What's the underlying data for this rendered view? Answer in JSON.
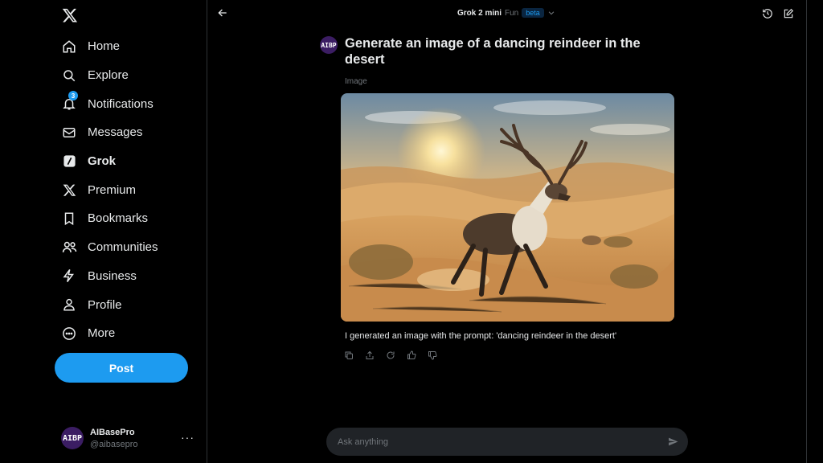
{
  "sidebar": {
    "logo": "x-logo-icon",
    "items": [
      {
        "label": "Home",
        "icon": "home-icon"
      },
      {
        "label": "Explore",
        "icon": "search-icon"
      },
      {
        "label": "Notifications",
        "icon": "bell-icon",
        "badge": "3"
      },
      {
        "label": "Messages",
        "icon": "envelope-icon"
      },
      {
        "label": "Grok",
        "icon": "grok-icon",
        "active": true
      },
      {
        "label": "Premium",
        "icon": "x-icon"
      },
      {
        "label": "Bookmarks",
        "icon": "bookmark-icon"
      },
      {
        "label": "Communities",
        "icon": "people-icon"
      },
      {
        "label": "Business",
        "icon": "lightning-icon"
      },
      {
        "label": "Profile",
        "icon": "person-icon"
      },
      {
        "label": "More",
        "icon": "more-circle-icon"
      }
    ],
    "post_label": "Post",
    "account": {
      "avatar_text": "AIBP",
      "name": "AIBasePro",
      "handle": "@aibasepro",
      "more": "···"
    }
  },
  "header": {
    "model_name": "Grok 2 mini",
    "mode": "Fun",
    "badge": "beta"
  },
  "conversation": {
    "avatar_text": "AIBP",
    "prompt": "Generate an image of a dancing reindeer in the desert",
    "image_label": "Image",
    "image_description": "reindeer-in-desert-image",
    "caption": "I generated an image with the prompt: 'dancing reindeer in the desert'"
  },
  "composer": {
    "placeholder": "Ask anything"
  },
  "colors": {
    "accent": "#1d9bf0",
    "background": "#000000",
    "text": "#e7e9ea",
    "muted": "#71767b"
  }
}
